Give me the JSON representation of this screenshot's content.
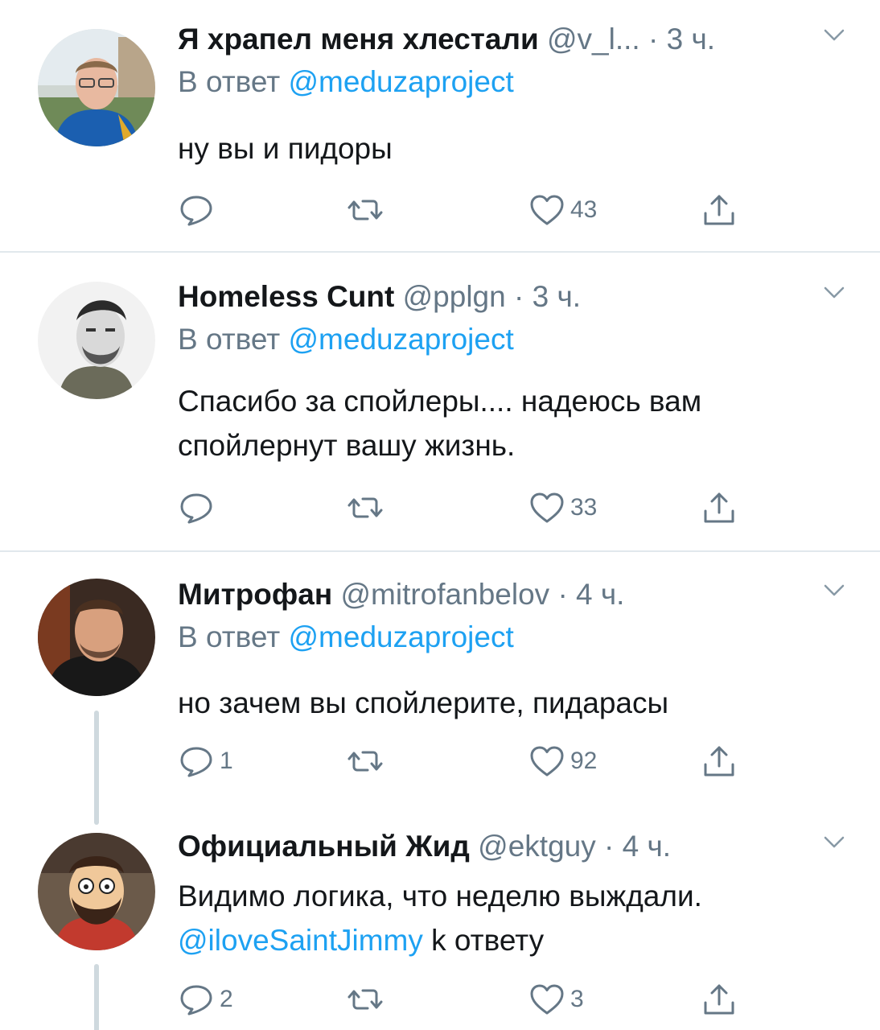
{
  "tweets": [
    {
      "name": "Я храпел меня хлестали",
      "handle": "@v_l...",
      "dot": "·",
      "time": "3 ч.",
      "reply_prefix": "В ответ",
      "reply_mention": "@meduzaproject",
      "text": "ну вы и пидоры",
      "reply_count": "",
      "retweet_count": "",
      "like_count": "43"
    },
    {
      "name": "Homeless Cunt",
      "handle": "@pplgn",
      "dot": "·",
      "time": "3 ч.",
      "reply_prefix": "В ответ",
      "reply_mention": "@meduzaproject",
      "text_line1": "Спасибо за спойлеры.... надеюсь вам",
      "text_line2": "спойлернут вашу жизнь.",
      "reply_count": "",
      "retweet_count": "",
      "like_count": "33"
    },
    {
      "name": "Митрофан",
      "handle": "@mitrofanbelov",
      "dot": "·",
      "time": "4 ч.",
      "reply_prefix": "В ответ",
      "reply_mention": "@meduzaproject",
      "text": "но зачем вы спойлерите, пидарасы",
      "reply_count": "1",
      "retweet_count": "",
      "like_count": "92"
    },
    {
      "name": "Официальный Жид",
      "handle": "@ektguy",
      "dot": "·",
      "time": "4 ч.",
      "text_line1": "Видимо логика, что неделю выждали.",
      "mention": "@iloveSaintJimmy",
      "text_suffix": " k ответу",
      "reply_count": "2",
      "retweet_count": "",
      "like_count": "3"
    }
  ],
  "icons": {
    "reply": "speech-bubble-icon",
    "retweet": "retweet-arrows-icon",
    "like": "heart-outline-icon",
    "share": "share-upload-icon",
    "more": "chevron-down-icon"
  },
  "colors": {
    "link": "#1da1f2",
    "secondary": "#657786",
    "divider": "#e1e8ed",
    "thread_line": "#cfd9de"
  }
}
